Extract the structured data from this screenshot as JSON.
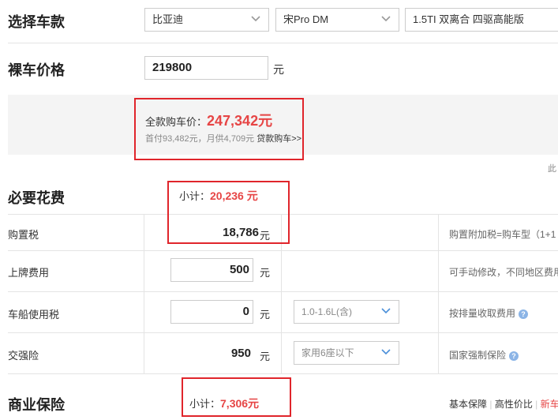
{
  "select_model": {
    "title": "选择车款",
    "brand": "比亚迪",
    "series": "宋Pro DM",
    "trim": "1.5TI 双离合 四驱高能版"
  },
  "bare_price": {
    "title": "裸车价格",
    "value": "219800",
    "unit": "元"
  },
  "full_price": {
    "label": "全款购车价：",
    "value": "247,342元",
    "sub": "首付93,482元，月供4,709元",
    "loan_link": "贷款购车>>",
    "side_text": "此"
  },
  "required": {
    "title": "必要花费",
    "subtotal_label": "小计：",
    "subtotal_value": "20,236 元",
    "rows": [
      {
        "label": "购置税",
        "value": "18,786",
        "unit": "元",
        "note": "购置附加税=购车型（1+1"
      },
      {
        "label": "上牌费用",
        "value": "500",
        "unit": "元",
        "note": "可手动修改，不同地区费用"
      },
      {
        "label": "车船使用税",
        "value": "0",
        "unit": "元",
        "select": "1.0-1.6L(含)",
        "note": "按排量收取费用"
      },
      {
        "label": "交强险",
        "value": "950",
        "unit": "元",
        "select": "家用6座以下",
        "note": "国家强制保险"
      }
    ]
  },
  "insurance": {
    "title": "商业保险",
    "subtotal_label": "小计：",
    "subtotal_value": "7,306元",
    "tabs": [
      "基本保障",
      "高性价比",
      "新车"
    ]
  }
}
